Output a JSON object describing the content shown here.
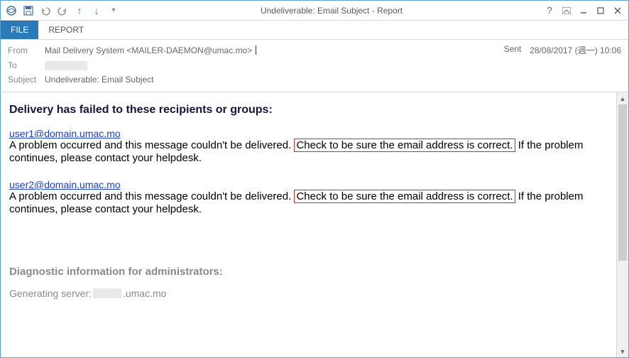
{
  "titlebar": {
    "title": "Undeliverable: Email Subject - Report"
  },
  "ribbon": {
    "file": "FILE",
    "report": "REPORT"
  },
  "headers": {
    "from_label": "From",
    "from_value": "Mail Delivery System <MAILER-DAEMON@umac.mo>",
    "to_label": "To",
    "subject_label": "Subject",
    "subject_value": "Undeliverable: Email Subject",
    "sent_label": "Sent",
    "sent_value": "28/08/2017 (週一) 10:06"
  },
  "body": {
    "heading": "Delivery has failed to these recipients or groups:",
    "recipients": [
      {
        "email": "user1@domain.umac.mo",
        "msg_before": "A problem occurred and this message couldn't be delivered. ",
        "msg_box": "Check to be sure the email address is correct.",
        "msg_after": " If the problem continues, please contact your helpdesk."
      },
      {
        "email": "user2@domain.umac.mo",
        "msg_before": "A problem occurred and this message couldn't be delivered. ",
        "msg_box": "Check to be sure the email address is correct.",
        "msg_after": " If the problem continues, please contact your helpdesk."
      }
    ],
    "diag_heading": "Diagnostic information for administrators:",
    "gen_server_label": "Generating server: ",
    "gen_server_suffix": ".umac.mo"
  }
}
